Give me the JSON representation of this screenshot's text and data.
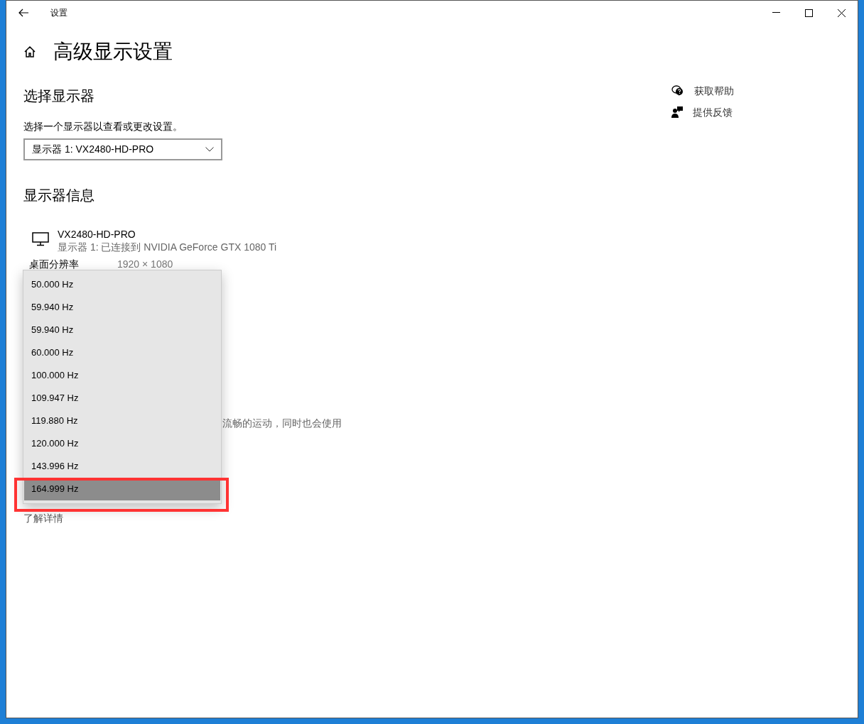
{
  "window": {
    "title": "设置"
  },
  "page_title": "高级显示设置",
  "select_display": {
    "heading": "选择显示器",
    "description": "选择一个显示器以查看或更改设置。",
    "dropdown_value": "显示器 1: VX2480-HD-PRO"
  },
  "display_info": {
    "heading": "显示器信息",
    "monitor_name": "VX2480-HD-PRO",
    "monitor_detail": "显示器 1: 已连接到 NVIDIA GeForce GTX 1080 Ti",
    "rows": [
      {
        "label": "桌面分辨率",
        "value": "1920 × 1080"
      }
    ]
  },
  "partial_text": "流畅的运动，同时也会使用",
  "link": "了解详情",
  "related": [
    {
      "kind": "help",
      "label": "获取帮助"
    },
    {
      "kind": "feedback",
      "label": "提供反馈"
    }
  ],
  "refresh_rate_menu": {
    "items": [
      {
        "label": "50.000 Hz",
        "selected": false
      },
      {
        "label": "59.940 Hz",
        "selected": false
      },
      {
        "label": "59.940 Hz",
        "selected": false
      },
      {
        "label": "60.000 Hz",
        "selected": false
      },
      {
        "label": "100.000 Hz",
        "selected": false
      },
      {
        "label": "109.947 Hz",
        "selected": false
      },
      {
        "label": "119.880 Hz",
        "selected": false
      },
      {
        "label": "120.000 Hz",
        "selected": false
      },
      {
        "label": "143.996 Hz",
        "selected": false
      },
      {
        "label": "164.999 Hz",
        "selected": true
      }
    ],
    "highlight_annotation": true
  }
}
